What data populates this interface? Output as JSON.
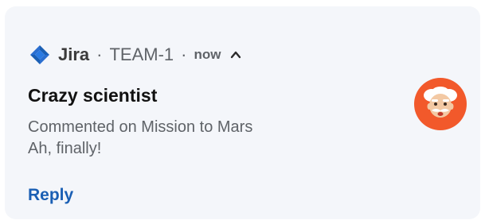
{
  "notification": {
    "app_name": "Jira",
    "separator": "·",
    "project": "TEAM-1",
    "time": "now",
    "title": "Crazy scientist",
    "line1": "Commented on Mission to Mars",
    "line2": "Ah, finally!",
    "action_label": "Reply"
  },
  "icons": {
    "app": "jira-logo-icon",
    "expand": "chevron-up-icon",
    "avatar": "scientist-avatar"
  },
  "colors": {
    "brand": "#1a5fb4",
    "avatar_bg": "#f2592b",
    "card_bg": "#f4f6fa"
  }
}
